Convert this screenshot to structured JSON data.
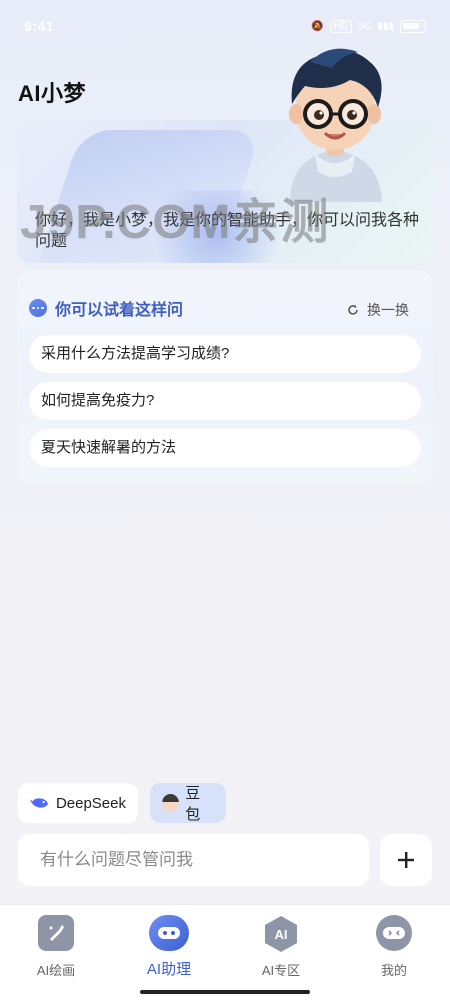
{
  "status_bar": {
    "time": "9:41",
    "signal_label": "5G",
    "hd_label": "HD",
    "battery_label": "100"
  },
  "page": {
    "title": "AI小梦"
  },
  "hero": {
    "greeting": "你好，我是小梦，我是你的智能助手，你可以问我各种问题"
  },
  "watermark": "J9P.COM亲测",
  "suggestions": {
    "title": "你可以试着这样问",
    "refresh_label": "换一换",
    "questions": [
      "采用什么方法提高学习成绩?",
      "如何提高免疫力?",
      "夏天快速解暑的方法"
    ]
  },
  "models": [
    {
      "label": "DeepSeek",
      "icon": "deepseek-whale-icon",
      "selected": false
    },
    {
      "label": "豆包",
      "icon": "doubao-avatar-icon",
      "selected": true
    }
  ],
  "input": {
    "placeholder": "有什么问题尽管问我"
  },
  "tabs": [
    {
      "label": "AI绘画",
      "icon": "paint-brush-icon",
      "active": false
    },
    {
      "label": "AI助理",
      "icon": "robot-chat-icon",
      "active": true
    },
    {
      "label": "AI专区",
      "icon": "ai-hexagon-icon",
      "active": false
    },
    {
      "label": "我的",
      "icon": "profile-robot-icon",
      "active": false
    }
  ],
  "colors": {
    "accent": "#3d5fd1",
    "tab_icon_gray": "#8e95a6",
    "selected_chip": "#d7e2fa"
  }
}
